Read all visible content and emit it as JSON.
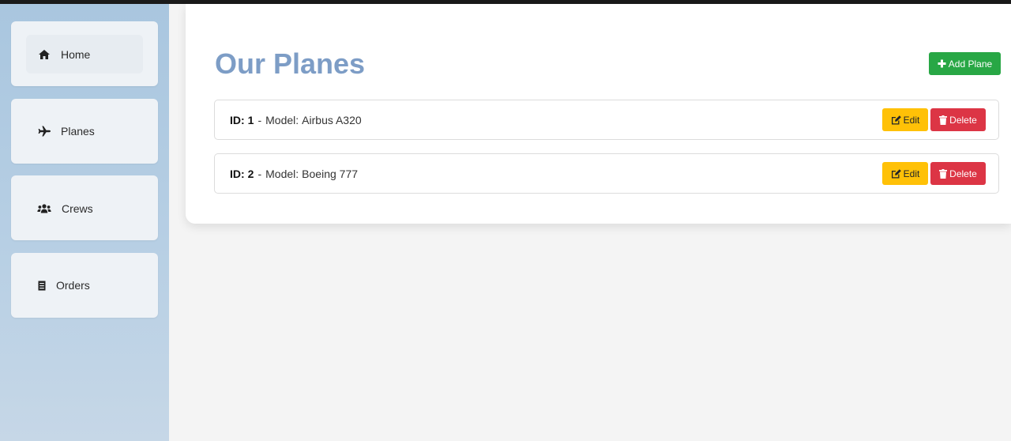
{
  "sidebar": {
    "items": [
      {
        "label": "Home",
        "icon": "home-icon",
        "active": true
      },
      {
        "label": "Planes",
        "icon": "plane-icon"
      },
      {
        "label": "Crews",
        "icon": "users-icon"
      },
      {
        "label": "Orders",
        "icon": "receipt-icon"
      }
    ]
  },
  "main": {
    "title": "Our Planes",
    "add_button": {
      "label": "Add Plane",
      "icon": "plus-icon"
    },
    "planes": [
      {
        "id_label": "ID:",
        "id": "1",
        "separator": "-",
        "model_label": "Model:",
        "model": "Airbus A320"
      },
      {
        "id_label": "ID:",
        "id": "2",
        "separator": "-",
        "model_label": "Model:",
        "model": "Boeing 777"
      }
    ],
    "edit_label": "Edit",
    "delete_label": "Delete"
  },
  "colors": {
    "title": "#7d9dc6",
    "add": "#28a745",
    "edit": "#ffc107",
    "delete": "#dc3545",
    "sidebar": "#a9c6df"
  }
}
